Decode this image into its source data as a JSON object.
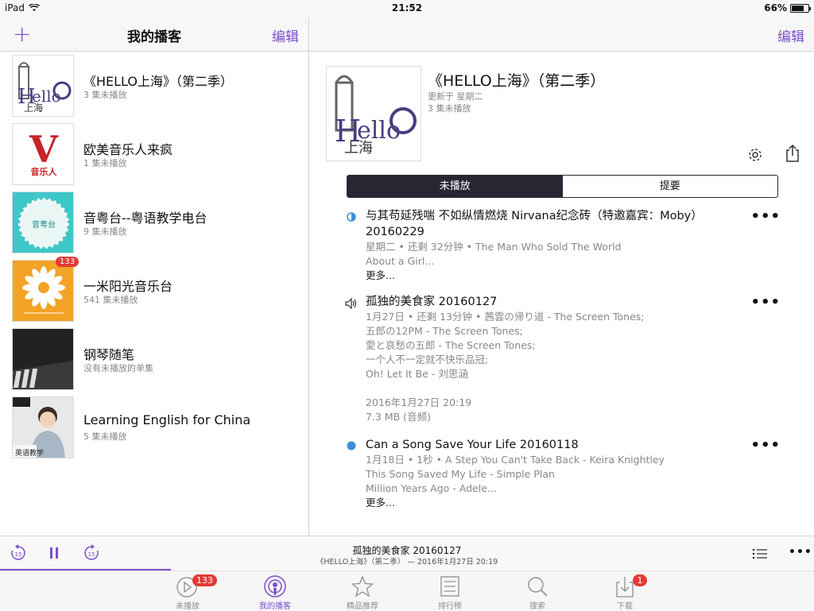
{
  "status": {
    "device": "iPad",
    "time": "21:52",
    "battery": "66%"
  },
  "left_nav": {
    "title": "我的播客",
    "edit": "编辑",
    "add": "+"
  },
  "podcasts": [
    {
      "title": "《HELLO上海》（第二季）",
      "subtitle": "3 集未播放"
    },
    {
      "title": "欧美音乐人来疯",
      "subtitle": "1 集未播放",
      "art_letter": "V",
      "art_caption": "音乐人"
    },
    {
      "title": "音粤台--粤语教学电台",
      "subtitle": "9 集未播放"
    },
    {
      "title": "一米阳光音乐台",
      "subtitle": "541 集未播放",
      "badge": "133"
    },
    {
      "title": "钢琴随笔",
      "subtitle": "没有未播放的单集"
    },
    {
      "title": "Learning English for China",
      "subtitle": "5 集未播放",
      "art_caption": "英语教学"
    }
  ],
  "right_nav": {
    "edit": "编辑"
  },
  "detail": {
    "title": "《HELLO上海》（第二季）",
    "updated": "更新于 星期二",
    "count": "3 集未播放",
    "segment_unplayed": "未播放",
    "segment_summary": "提要"
  },
  "episodes": [
    {
      "title": "与其苟延残喘 不如纵情燃烧 Nirvana纪念砖（特邀嘉宾：Moby）20160229",
      "lines": [
        "星期二 • 还剩 32分钟 • The Man Who Sold The World",
        "About a Girl..."
      ],
      "more": "更多...",
      "state": "half"
    },
    {
      "title": "孤独的美食家 20160127",
      "lines": [
        "1月27日 • 还剩 13分钟 • 茜雲の帰り道 - The Screen Tones;",
        "五郎の12PM - The Screen Tones;",
        "愛と哀愁の五郎 - The Screen Tones;",
        "一个人不一定就不快乐品冠;",
        "Oh! Let It Be - 刘思涵",
        "",
        "2016年1月27日 20:19",
        "7.3 MB (音频)"
      ],
      "more": "",
      "state": "playing"
    },
    {
      "title": "Can a Song Save Your Life 20160118",
      "lines": [
        "1月18日 • 1秒 • A Step You Can't Take Back - Keira Knightley",
        "This Song Saved My Life - Simple Plan",
        "Million Years Ago - Adele..."
      ],
      "more": "更多...",
      "state": "new"
    }
  ],
  "player": {
    "title": "孤独的美食家 20160127",
    "subtitle": "《HELLO上海》（第二季） — 2016年1月27日 20:19",
    "back_seconds": "15",
    "forward_seconds": "15",
    "progress": 0.21
  },
  "tabs": [
    {
      "label": "未播放",
      "badge": "133"
    },
    {
      "label": "我的播客"
    },
    {
      "label": "精品推荐"
    },
    {
      "label": "排行榜"
    },
    {
      "label": "搜索"
    },
    {
      "label": "下载",
      "badge": "1"
    }
  ],
  "colors": {
    "accent": "#7b4fc9",
    "badge": "#e23a36",
    "segment": "#2a2533",
    "dot": "#3a8fd9"
  }
}
